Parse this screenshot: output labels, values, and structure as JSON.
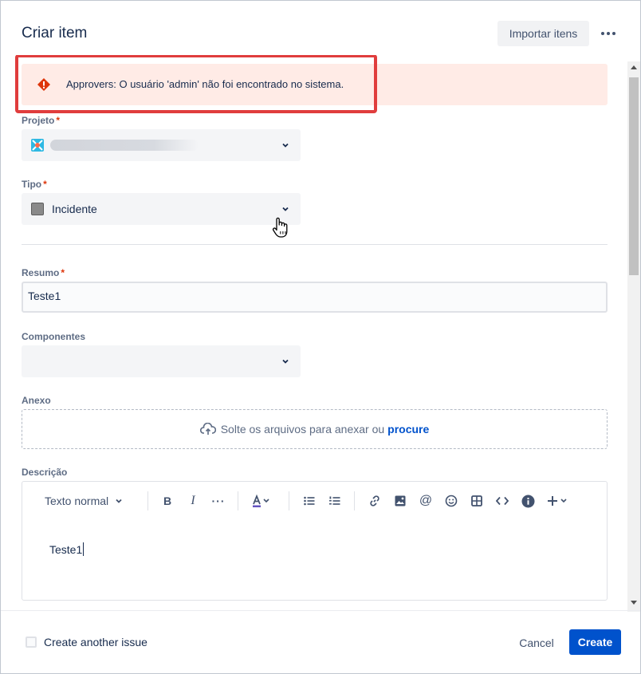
{
  "dialog": {
    "title": "Criar item",
    "import_label": "Importar itens"
  },
  "error": {
    "message": "Approvers: O usuário 'admin' não foi encontrado no sistema."
  },
  "fields": {
    "project": {
      "label": "Projeto",
      "required": "*"
    },
    "type": {
      "label": "Tipo",
      "required": "*",
      "value": "Incidente"
    },
    "summary": {
      "label": "Resumo",
      "required": "*",
      "value": "Teste1"
    },
    "components": {
      "label": "Componentes",
      "value": ""
    },
    "attachment": {
      "label": "Anexo",
      "drop_text": "Solte os arquivos para anexar ou",
      "browse_link": "procure"
    },
    "description": {
      "label": "Descrição",
      "text_style": "Texto normal",
      "body": "Teste1"
    }
  },
  "footer": {
    "create_another_label": "Create another issue",
    "cancel_label": "Cancel",
    "create_label": "Create"
  },
  "icons": {
    "error": "warning-diamond-icon",
    "project": "project-avatar-icon",
    "type": "incident-type-icon",
    "more": "more-icon"
  },
  "colors": {
    "primary": "#0052cc",
    "error_bg": "#ffebe6",
    "error_icon": "#de350b",
    "highlight_border": "#e03d3d",
    "required": "#de350b"
  }
}
